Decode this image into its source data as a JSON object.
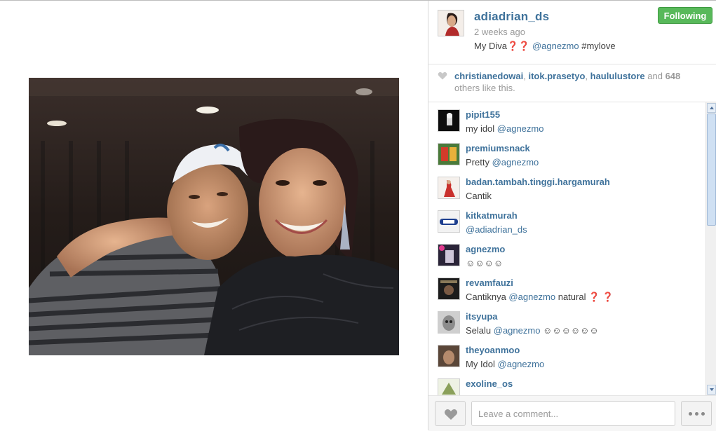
{
  "post": {
    "owner_username": "adiadrian_ds",
    "time_ago": "2 weeks ago",
    "caption_text": "My Diva❓❓ ",
    "caption_mention": "@agnezmo",
    "caption_hashtag": " #mylove",
    "follow_label": "Following"
  },
  "likes": {
    "likers": [
      "christianedowai",
      "itok.prasetyo",
      "haululustore"
    ],
    "sep1": ", ",
    "sep2": ", ",
    "and_text": " and ",
    "count": "648",
    "suffix": " others like this."
  },
  "comments": [
    {
      "user": "pipit155",
      "text": "my idol ",
      "mention": "@agnezmo",
      "after": ""
    },
    {
      "user": "premiumsnack",
      "text": "Pretty ",
      "mention": "@agnezmo",
      "after": ""
    },
    {
      "user": "badan.tambah.tinggi.hargamurah",
      "text": "Cantik",
      "mention": "",
      "after": ""
    },
    {
      "user": "kitkatmurah",
      "text": "",
      "mention": "@adiadrian_ds",
      "after": ""
    },
    {
      "user": "agnezmo",
      "text": "☺☺☺☺",
      "mention": "",
      "after": ""
    },
    {
      "user": "revamfauzi",
      "text": "Cantiknya ",
      "mention": "@agnezmo",
      "after": " natural ❓ ❓"
    },
    {
      "user": "itsyupa",
      "text": "Selalu ",
      "mention": "@agnezmo",
      "after": " ☺☺☺☺☺☺"
    },
    {
      "user": "theyoanmoo",
      "text": "My Idol ",
      "mention": "@agnezmo",
      "after": ""
    },
    {
      "user": "exoline_os",
      "text": "☺☺",
      "mention": "",
      "after": ""
    }
  ],
  "comment_box": {
    "placeholder": "Leave a comment..."
  },
  "icons": {
    "like": "heart-icon",
    "more": "more-dots-icon",
    "scroll_up": "scroll-up-arrow",
    "scroll_down": "scroll-down-arrow"
  },
  "colors": {
    "username": "#3f729b",
    "follow_button": "#58b95a",
    "muted": "#999999"
  }
}
